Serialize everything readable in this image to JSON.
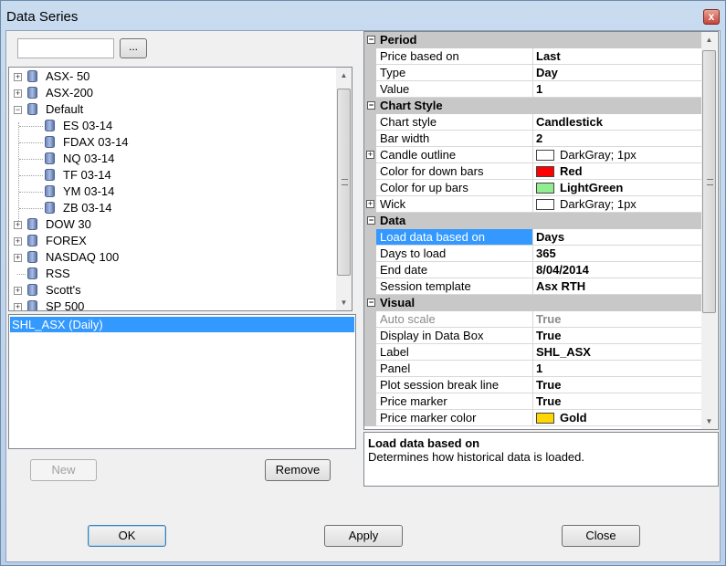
{
  "window": {
    "title": "Data Series",
    "close_label": "x"
  },
  "search": {
    "value": "",
    "browse_label": "..."
  },
  "tree": {
    "items": [
      {
        "label": "ASX- 50",
        "level": 0,
        "expander": "+"
      },
      {
        "label": "ASX-200",
        "level": 0,
        "expander": "+"
      },
      {
        "label": "Default",
        "level": 0,
        "expander": "-"
      },
      {
        "label": "ES 03-14",
        "level": 1,
        "expander": ""
      },
      {
        "label": "FDAX 03-14",
        "level": 1,
        "expander": ""
      },
      {
        "label": "NQ 03-14",
        "level": 1,
        "expander": ""
      },
      {
        "label": "TF 03-14",
        "level": 1,
        "expander": ""
      },
      {
        "label": "YM 03-14",
        "level": 1,
        "expander": ""
      },
      {
        "label": "ZB 03-14",
        "level": 1,
        "expander": ""
      },
      {
        "label": "DOW 30",
        "level": 0,
        "expander": "+"
      },
      {
        "label": "FOREX",
        "level": 0,
        "expander": "+"
      },
      {
        "label": "NASDAQ 100",
        "level": 0,
        "expander": "+"
      },
      {
        "label": "RSS",
        "level": 0,
        "expander": ""
      },
      {
        "label": "Scott's",
        "level": 0,
        "expander": "+"
      },
      {
        "label": "SP 500",
        "level": 0,
        "expander": "+"
      }
    ]
  },
  "series_list": {
    "selected": "SHL_ASX (Daily)"
  },
  "buttons": {
    "new": "New",
    "remove": "Remove",
    "ok": "OK",
    "apply": "Apply",
    "close": "Close"
  },
  "grid": {
    "rows": [
      {
        "type": "cat",
        "label": "Period",
        "expander": "-"
      },
      {
        "type": "prop",
        "name": "Price based on",
        "value": "Last"
      },
      {
        "type": "prop",
        "name": "Type",
        "value": "Day"
      },
      {
        "type": "prop",
        "name": "Value",
        "value": "1"
      },
      {
        "type": "cat",
        "label": "Chart Style",
        "expander": "-"
      },
      {
        "type": "prop",
        "name": "Chart style",
        "value": "Candlestick"
      },
      {
        "type": "prop",
        "name": "Bar width",
        "value": "2"
      },
      {
        "type": "prop",
        "name": "Candle outline",
        "value": "DarkGray; 1px",
        "swatch": "#ffffff",
        "plain": true,
        "expander": "+"
      },
      {
        "type": "prop",
        "name": "Color for down bars",
        "value": "Red",
        "swatch": "#ff0000"
      },
      {
        "type": "prop",
        "name": "Color for up bars",
        "value": "LightGreen",
        "swatch": "#90ee90"
      },
      {
        "type": "prop",
        "name": "Wick",
        "value": "DarkGray; 1px",
        "swatch": "#ffffff",
        "plain": true,
        "expander": "+"
      },
      {
        "type": "cat",
        "label": "Data",
        "expander": "-"
      },
      {
        "type": "prop",
        "name": "Load data based on",
        "value": "Days",
        "selected": true
      },
      {
        "type": "prop",
        "name": "Days to load",
        "value": "365"
      },
      {
        "type": "prop",
        "name": "End date",
        "value": "8/04/2014"
      },
      {
        "type": "prop",
        "name": "Session template",
        "value": "Asx RTH"
      },
      {
        "type": "cat",
        "label": "Visual",
        "expander": "-"
      },
      {
        "type": "prop",
        "name": "Auto scale",
        "value": "True",
        "dim": true
      },
      {
        "type": "prop",
        "name": "Display in Data Box",
        "value": "True"
      },
      {
        "type": "prop",
        "name": "Label",
        "value": "SHL_ASX"
      },
      {
        "type": "prop",
        "name": "Panel",
        "value": "1"
      },
      {
        "type": "prop",
        "name": "Plot session break line",
        "value": "True"
      },
      {
        "type": "prop",
        "name": "Price marker",
        "value": "True"
      },
      {
        "type": "prop",
        "name": "Price marker color",
        "value": "Gold",
        "swatch": "#ffd700"
      }
    ]
  },
  "description": {
    "title": "Load data based on",
    "text": "Determines how historical data is loaded."
  },
  "colors": {
    "selection": "#3399ff",
    "category_bg": "#c8c8c8"
  }
}
